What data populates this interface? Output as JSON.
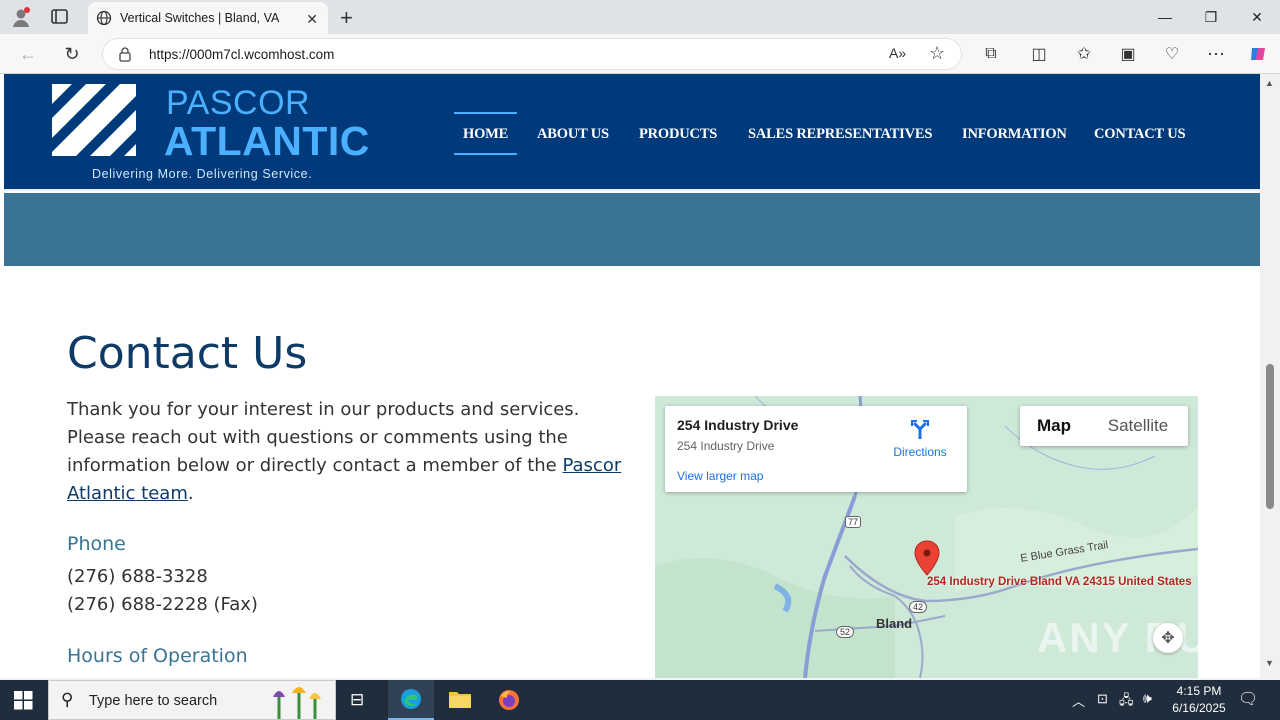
{
  "browser": {
    "tab_title": "Vertical Switches | Bland, VA",
    "url": "https://000m7cl.wcomhost.com"
  },
  "header": {
    "logo_line1": "PASCOR",
    "logo_line2": "ATLANTIC",
    "tagline": "Delivering More. Delivering Service.",
    "nav": [
      "HOME",
      "ABOUT US",
      "PRODUCTS",
      "SALES REPRESENTATIVES",
      "INFORMATION",
      "CONTACT US"
    ]
  },
  "content": {
    "heading": "Contact Us",
    "intro": "Thank you for your interest in our products and services. Please reach out with questions or comments using the information below or directly contact a member of the ",
    "intro_link": "Pascor Atlantic team",
    "intro_end": ".",
    "phone_heading": "Phone",
    "phone": "(276) 688-3328",
    "fax": "(276) 688-2228 (Fax)",
    "hours_heading": "Hours of Operation"
  },
  "map": {
    "place_title": "254 Industry Drive",
    "place_address": "254 Industry Drive",
    "directions": "Directions",
    "larger_map": "View larger map",
    "map_btn": "Map",
    "satellite_btn": "Satellite",
    "marker_label": "254 Industry Drive Bland VA 24315 United States",
    "town": "Bland",
    "road_label": "E Blue Grass Trail",
    "shield_77": "77",
    "shield_52": "52",
    "shield_42": "42"
  },
  "watermark": "ANY RUN",
  "taskbar": {
    "search_placeholder": "Type here to search",
    "time": "4:15 PM",
    "date": "6/16/2025"
  }
}
